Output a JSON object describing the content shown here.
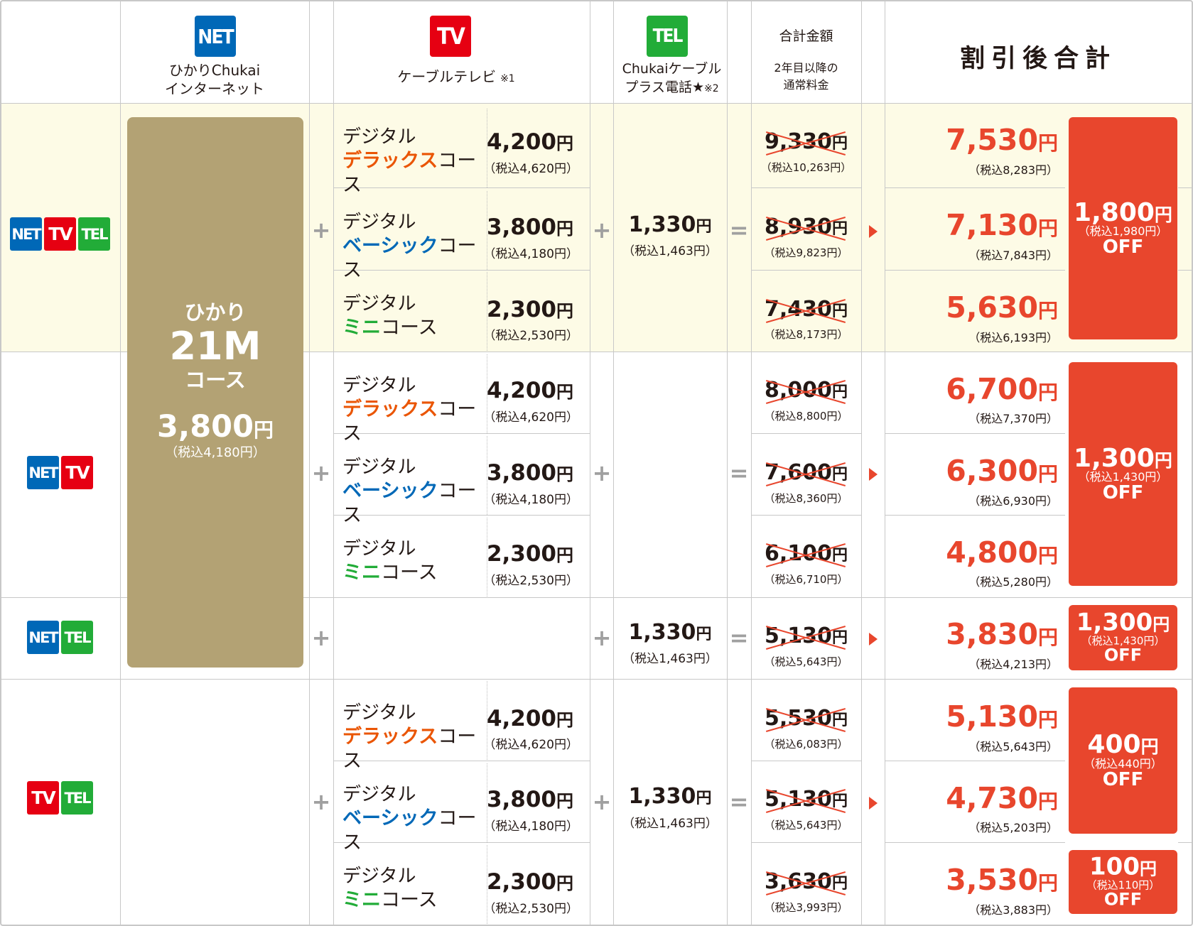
{
  "header": {
    "net_icon": "NET",
    "net_label": "ひかりChukai\nインターネット",
    "tv_icon": "TV",
    "tv_label": "ケーブルテレビ",
    "tv_note": "※1",
    "tel_icon": "TEL",
    "tel_label": "Chukaiケーブル\nプラス電話★",
    "tel_note": "※2",
    "total_label": "合計金額",
    "total_sub": "2年目以降の\n通常料金",
    "discount_label": "割引後合計"
  },
  "row_badges": {
    "net": "NET",
    "tv": "TV",
    "tel": "TEL"
  },
  "plan": {
    "line1": "ひかり",
    "line2": "21M",
    "line3": "コース",
    "price": "3,800",
    "yen": "円",
    "tax": "（税込4,180円）"
  },
  "symbols": {
    "plus": "+",
    "equals": "="
  },
  "tel_price": {
    "price": "1,330",
    "yen": "円",
    "tax": "（税込1,463円）"
  },
  "courses": {
    "deluxe": {
      "top": "デジタル",
      "color_word": "デラックス",
      "suffix": "コース",
      "color": "#ea5504",
      "price": "4,200",
      "tax": "（税込4,620円）"
    },
    "basic": {
      "top": "デジタル",
      "color_word": "ベーシック",
      "suffix": "コース",
      "color": "#0068b7",
      "price": "3,800",
      "tax": "（税込4,180円）"
    },
    "mini": {
      "top": "デジタル",
      "color_word": "ミニ",
      "suffix": "コース",
      "color": "#22ac38",
      "price": "2,300",
      "tax": "（税込2,530円）"
    }
  },
  "groups": [
    {
      "name": "NET+TV+TEL",
      "rows": [
        {
          "total": "9,330",
          "total_tax": "（税込10,263円）",
          "disc": "7,530",
          "disc_tax": "（税込8,283円）"
        },
        {
          "total": "8,930",
          "total_tax": "（税込9,823円）",
          "disc": "7,130",
          "disc_tax": "（税込7,843円）"
        },
        {
          "total": "7,430",
          "total_tax": "（税込8,173円）",
          "disc": "5,630",
          "disc_tax": "（税込6,193円）"
        }
      ],
      "off": {
        "amount": "1,800",
        "tax": "（税込1,980円）",
        "word": "OFF"
      }
    },
    {
      "name": "NET+TV",
      "rows": [
        {
          "total": "8,000",
          "total_tax": "（税込8,800円）",
          "disc": "6,700",
          "disc_tax": "（税込7,370円）"
        },
        {
          "total": "7,600",
          "total_tax": "（税込8,360円）",
          "disc": "6,300",
          "disc_tax": "（税込6,930円）"
        },
        {
          "total": "6,100",
          "total_tax": "（税込6,710円）",
          "disc": "4,800",
          "disc_tax": "（税込5,280円）"
        }
      ],
      "off": {
        "amount": "1,300",
        "tax": "（税込1,430円）",
        "word": "OFF"
      }
    },
    {
      "name": "NET+TEL",
      "rows": [
        {
          "total": "5,130",
          "total_tax": "（税込5,643円）",
          "disc": "3,830",
          "disc_tax": "（税込4,213円）"
        }
      ],
      "off": {
        "amount": "1,300",
        "tax": "（税込1,430円）",
        "word": "OFF"
      }
    },
    {
      "name": "TV+TEL",
      "rows": [
        {
          "total": "5,530",
          "total_tax": "（税込6,083円）",
          "disc": "5,130",
          "disc_tax": "（税込5,643円）"
        },
        {
          "total": "5,130",
          "total_tax": "（税込5,643円）",
          "disc": "4,730",
          "disc_tax": "（税込5,203円）"
        },
        {
          "total": "3,630",
          "total_tax": "（税込3,993円）",
          "disc": "3,530",
          "disc_tax": "（税込3,883円）"
        }
      ],
      "off": {
        "amount": "400",
        "tax": "（税込440円）",
        "word": "OFF"
      },
      "off2": {
        "amount": "100",
        "tax": "（税込110円）",
        "word": "OFF"
      }
    }
  ],
  "colors": {
    "net": "#0068b7",
    "tv": "#e60012",
    "tel": "#22ac38",
    "accent": "#e8462d",
    "gold": "#b3a274",
    "highlight_bg": "#fdfbe6"
  }
}
